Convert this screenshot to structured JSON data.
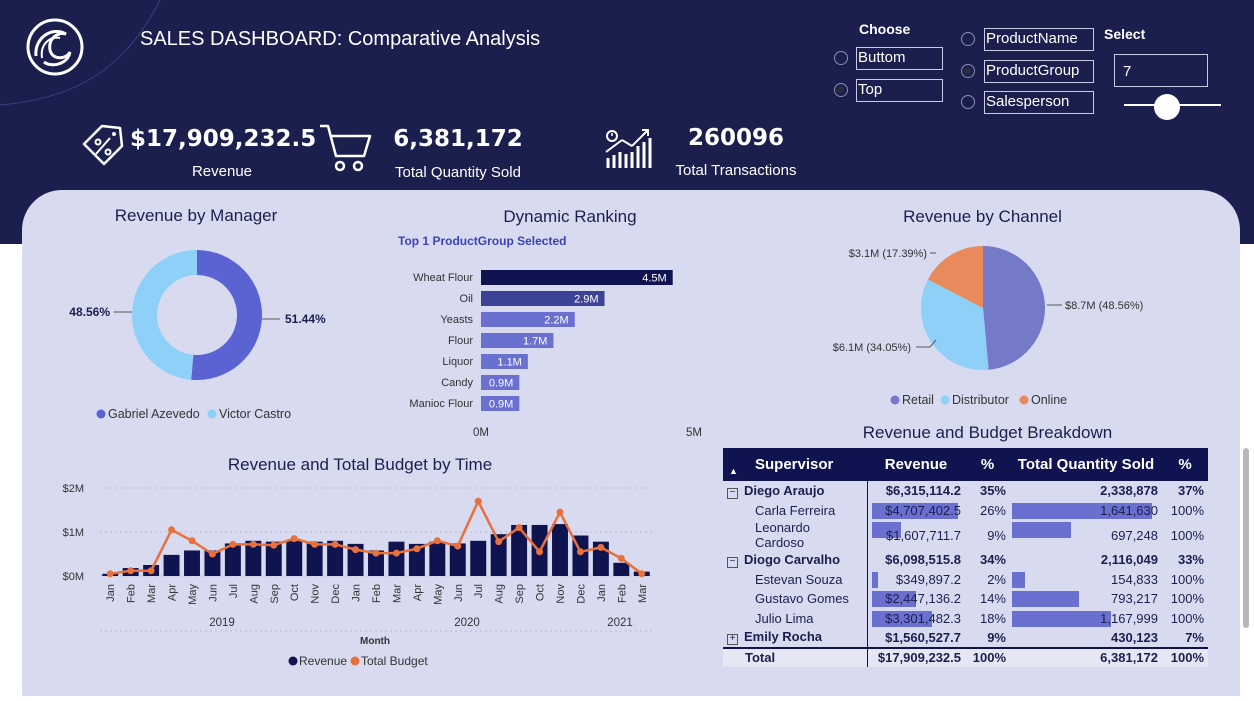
{
  "header": {
    "title": "SALES DASHBOARD: Comparative Analysis"
  },
  "kpis": [
    {
      "value": "$17,909,232.5",
      "label": "Revenue",
      "icon": "price-tag-icon"
    },
    {
      "value": "6,381,172",
      "label": "Total Quantity Sold",
      "icon": "shopping-cart-icon"
    },
    {
      "value": "260096",
      "label": "Total Transactions",
      "icon": "growth-chart-icon"
    }
  ],
  "controls": {
    "choose_label": "Choose",
    "order_options": [
      {
        "label": "Buttom",
        "selected": false
      },
      {
        "label": "Top",
        "selected": true
      }
    ],
    "dimension_options": [
      {
        "label": "ProductName",
        "selected": false
      },
      {
        "label": "ProductGroup",
        "selected": true
      },
      {
        "label": "Salesperson",
        "selected": false
      }
    ],
    "select_label": "Select",
    "select_value": "7",
    "slider_value": 7
  },
  "revenue_by_manager": {
    "title": "Revenue by Manager",
    "label_left": "48.56%",
    "label_right": "51.44%",
    "legend": [
      "Gabriel Azevedo",
      "Victor Castro"
    ],
    "colors": [
      "#5b63d3",
      "#8fd0f8"
    ]
  },
  "dynamic_ranking": {
    "title": "Dynamic Ranking",
    "subtitle": "Top 1 ProductGroup Selected",
    "axis_min_label": "0M",
    "axis_max_label": "5M"
  },
  "revenue_by_channel": {
    "title": "Revenue by Channel",
    "label_online": "$3.1M (17.39%)",
    "label_retail": "$8.7M (48.56%)",
    "label_distributor": "$6.1M (34.05%)",
    "legend": [
      "Retail",
      "Distributor",
      "Online"
    ],
    "colors": [
      "#7479c8",
      "#8fd0f8",
      "#e98a5c"
    ]
  },
  "time_chart": {
    "title": "Revenue and Total Budget by Time",
    "xlabel": "Month",
    "legend": [
      "Revenue",
      "Total Budget"
    ],
    "colors": [
      "#0f1350",
      "#e8703a"
    ],
    "year_labels": [
      "2019",
      "2020",
      "2021"
    ]
  },
  "breakdown": {
    "title": "Revenue and Budget Breakdown",
    "columns": [
      "Supervisor",
      "Revenue",
      "%",
      "Total Quantity Sold",
      "%"
    ],
    "rows": [
      {
        "kind": "group",
        "name": "Diego Araujo",
        "revenue": "$6,315,114.2",
        "pct": "35%",
        "qty": "2,338,878",
        "qpct": "37%"
      },
      {
        "kind": "child",
        "name": "Carla Ferreira",
        "revenue": "$4,707,402.5",
        "pct": "26%",
        "qty": "1,641,630",
        "qpct": "100%",
        "rev_share": 1.0,
        "qty_share": 1.0
      },
      {
        "kind": "child",
        "name": "Leonardo Cardoso",
        "revenue": "$1,607,711.7",
        "pct": "9%",
        "qty": "697,248",
        "qpct": "100%",
        "rev_share": 0.34,
        "qty_share": 0.42
      },
      {
        "kind": "group",
        "name": "Diogo Carvalho",
        "revenue": "$6,098,515.8",
        "pct": "34%",
        "qty": "2,116,049",
        "qpct": "33%"
      },
      {
        "kind": "child",
        "name": "Estevan Souza",
        "revenue": "$349,897.2",
        "pct": "2%",
        "qty": "154,833",
        "qpct": "100%",
        "rev_share": 0.07,
        "qty_share": 0.09
      },
      {
        "kind": "child",
        "name": "Gustavo Gomes",
        "revenue": "$2,447,136.2",
        "pct": "14%",
        "qty": "793,217",
        "qpct": "100%",
        "rev_share": 0.52,
        "qty_share": 0.48
      },
      {
        "kind": "child",
        "name": "Julio Lima",
        "revenue": "$3,301,482.3",
        "pct": "18%",
        "qty": "1,167,999",
        "qpct": "100%",
        "rev_share": 0.7,
        "qty_share": 0.71
      },
      {
        "kind": "group",
        "name": "Emily Rocha",
        "revenue": "$1,560,527.7",
        "pct": "9%",
        "qty": "430,123",
        "qpct": "7%"
      }
    ],
    "total": {
      "name": "Total",
      "revenue": "$17,909,232.5",
      "pct": "100%",
      "qty": "6,381,172",
      "qpct": "100%"
    }
  },
  "chart_data": [
    {
      "type": "pie",
      "title": "Revenue by Manager",
      "categories": [
        "Gabriel Azevedo",
        "Victor Castro"
      ],
      "values": [
        51.44,
        48.56
      ],
      "donut": true
    },
    {
      "type": "bar",
      "title": "Dynamic Ranking",
      "orientation": "horizontal",
      "categories": [
        "Wheat Flour",
        "Oil",
        "Yeasts",
        "Flour",
        "Liquor",
        "Candy",
        "Manioc Flour"
      ],
      "values": [
        4.5,
        2.9,
        2.2,
        1.7,
        1.1,
        0.9,
        0.9
      ],
      "value_labels": [
        "4.5M",
        "2.9M",
        "2.2M",
        "1.7M",
        "1.1M",
        "0.9M",
        "0.9M"
      ],
      "xlim": [
        0,
        5
      ],
      "highlight_first": true
    },
    {
      "type": "pie",
      "title": "Revenue by Channel",
      "categories": [
        "Retail",
        "Distributor",
        "Online"
      ],
      "values": [
        48.56,
        34.05,
        17.39
      ]
    },
    {
      "type": "bar",
      "title": "Revenue and Total Budget by Time",
      "x": [
        "Jan",
        "Feb",
        "Mar",
        "Apr",
        "May",
        "Jun",
        "Jul",
        "Aug",
        "Sep",
        "Oct",
        "Nov",
        "Dec",
        "Jan",
        "Feb",
        "Mar",
        "Apr",
        "May",
        "Jun",
        "Jul",
        "Aug",
        "Sep",
        "Oct",
        "Nov",
        "Dec",
        "Jan",
        "Feb",
        "Mar"
      ],
      "ylim": [
        0,
        2
      ],
      "ytick_labels": [
        "$0M",
        "$1M",
        "$2M"
      ],
      "series": [
        {
          "name": "Revenue",
          "type": "bar",
          "values": [
            0.05,
            0.18,
            0.25,
            0.48,
            0.58,
            0.58,
            0.74,
            0.8,
            0.78,
            0.8,
            0.78,
            0.8,
            0.73,
            0.58,
            0.78,
            0.73,
            0.78,
            0.74,
            0.8,
            0.95,
            1.16,
            1.16,
            1.18,
            0.92,
            0.78,
            0.3,
            0.1
          ]
        },
        {
          "name": "Total Budget",
          "type": "line",
          "values": [
            0.05,
            0.12,
            0.12,
            1.05,
            0.8,
            0.5,
            0.72,
            0.72,
            0.7,
            0.85,
            0.72,
            0.72,
            0.6,
            0.52,
            0.52,
            0.62,
            0.8,
            0.68,
            1.7,
            0.78,
            1.1,
            0.55,
            1.45,
            0.55,
            0.65,
            0.4,
            0.05
          ]
        }
      ]
    }
  ]
}
